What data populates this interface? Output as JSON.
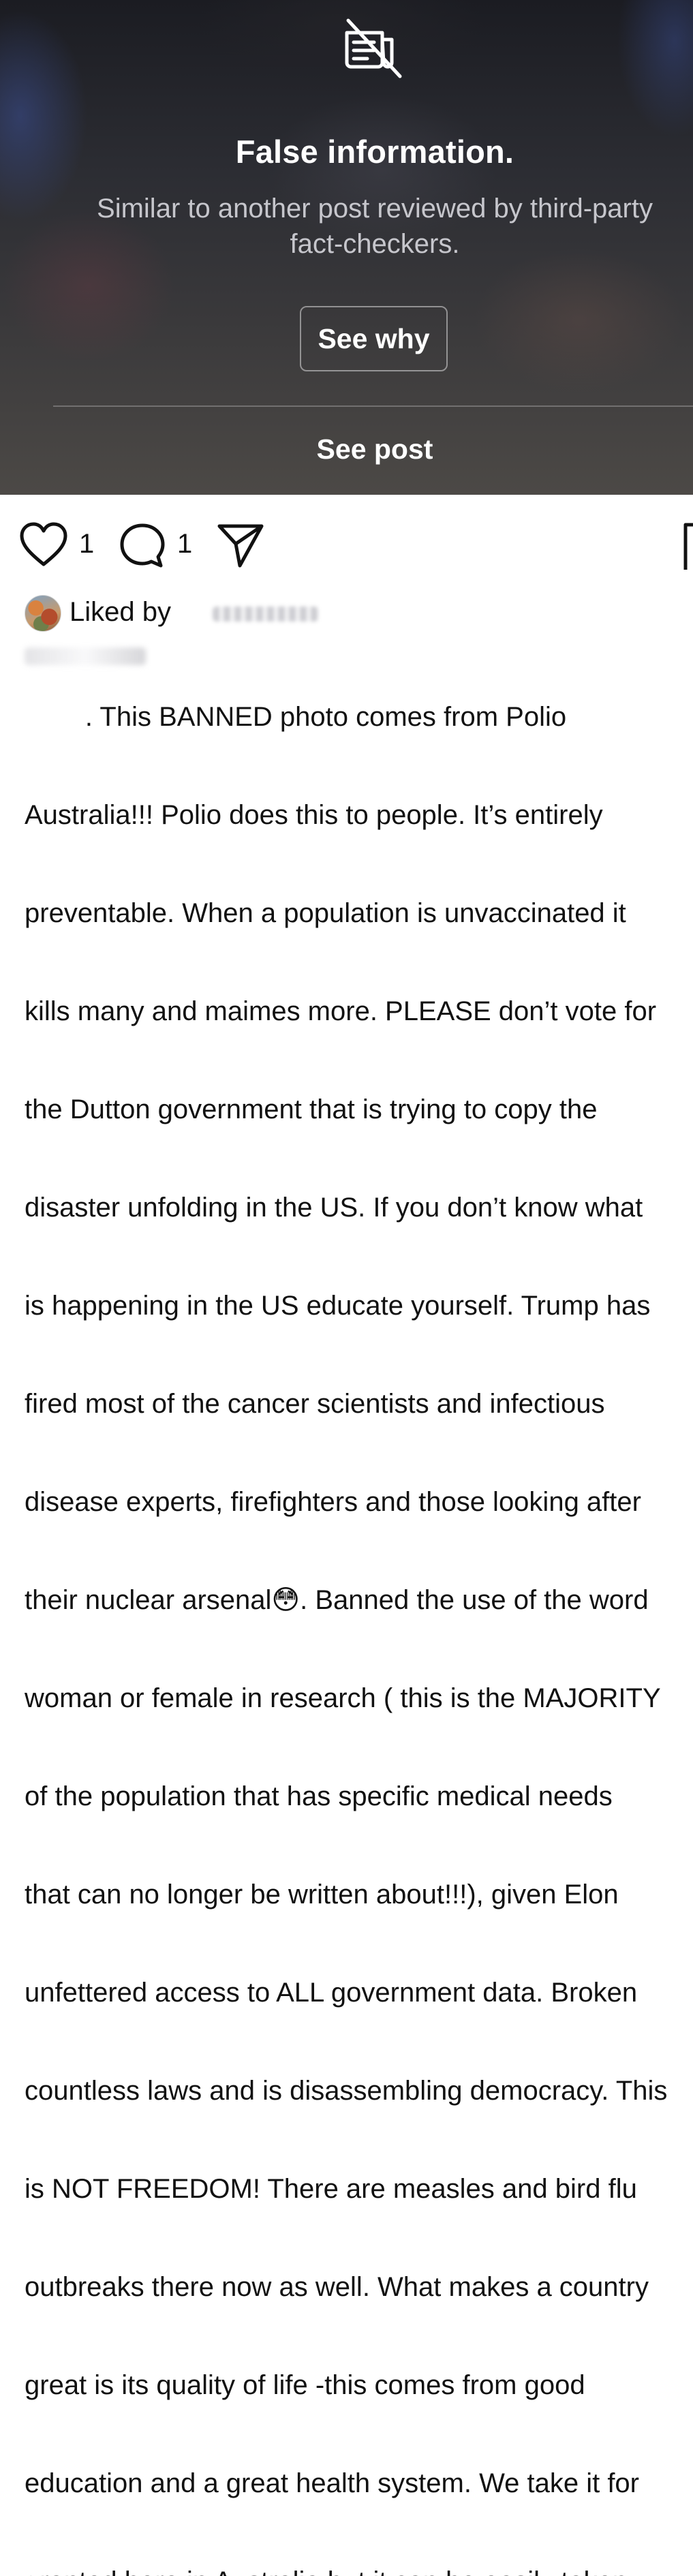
{
  "overlay": {
    "icon": "news-off-icon",
    "title": "False information.",
    "subtitle_line1": "Similar to another post reviewed by third-party",
    "subtitle_line2": "fact-checkers.",
    "see_why_label": "See why",
    "see_post_label": "See post"
  },
  "actions": {
    "like_icon": "heart-icon",
    "like_count": "1",
    "comment_icon": "comment-icon",
    "comment_count": "1",
    "share_icon": "send-icon",
    "save_icon": "bookmark-icon"
  },
  "liked_by": {
    "label": "Liked by"
  },
  "caption": {
    "lines": [
      "        . This BANNED photo comes from Polio",
      "Australia!!! Polio does this to people. It’s entirely",
      "preventable. When a population is unvaccinated it",
      "kills many and maimes more. PLEASE don’t vote for",
      "the Dutton government that is trying to copy the",
      "disaster unfolding in the US. If you don’t know what",
      "is happening in the US educate yourself. Trump has",
      "fired most of the cancer scientists and infectious",
      "disease experts, firefighters and those looking after",
      "their nuclear arsenal😳. Banned the use of the word",
      "woman or female in research ( this is the MAJORITY",
      "of the population that has specific medical needs",
      "that can no longer be written about!!!), given Elon",
      "unfettered access to ALL government data. Broken",
      "countless laws and is disassembling democracy. This",
      "is NOT FREEDOM! There are measles and bird flu",
      "outbreaks there now as well. What makes a country",
      "great is its quality of life -this comes from good",
      "education and a great health system. We take it for",
      "granted here in Australia but it can be easily taken"
    ]
  }
}
